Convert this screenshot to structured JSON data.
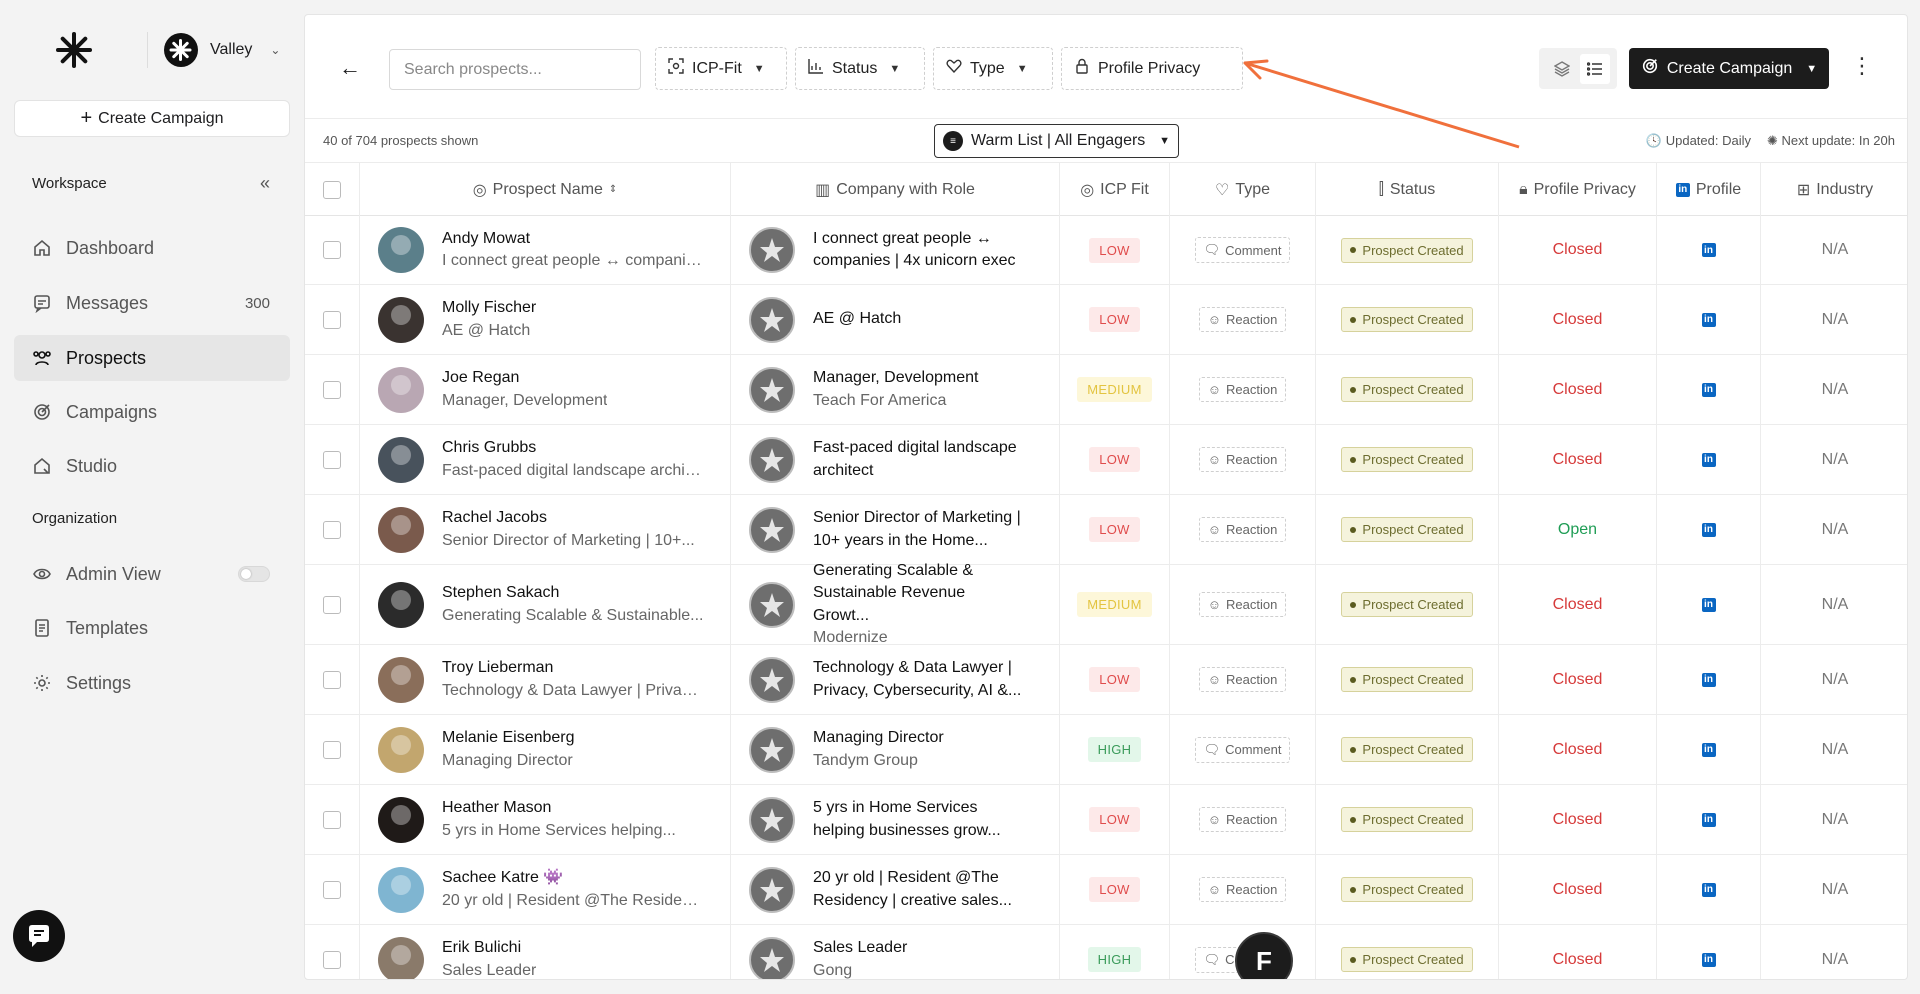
{
  "workspace": {
    "name": "Valley"
  },
  "sidebar": {
    "create_label": "Create Campaign",
    "workspace_label": "Workspace",
    "organization_label": "Organization",
    "items": [
      {
        "label": "Dashboard",
        "icon": "home-icon"
      },
      {
        "label": "Messages",
        "icon": "message-icon",
        "count": "300"
      },
      {
        "label": "Prospects",
        "icon": "users-icon",
        "active": true
      },
      {
        "label": "Campaigns",
        "icon": "target-icon"
      },
      {
        "label": "Studio",
        "icon": "studio-icon"
      }
    ],
    "org_items": [
      {
        "label": "Admin View",
        "icon": "eye-icon"
      },
      {
        "label": "Templates",
        "icon": "document-icon"
      },
      {
        "label": "Settings",
        "icon": "gear-icon"
      }
    ]
  },
  "toolbar": {
    "search_placeholder": "Search prospects...",
    "filters": [
      "ICP-Fit",
      "Status",
      "Type",
      "Profile Privacy"
    ],
    "create_label": "Create Campaign"
  },
  "subbar": {
    "count_text": "40 of 704 prospects shown",
    "list_label": "Warm List | All Engagers",
    "updated": "Updated: Daily",
    "next_update": "Next update: In 20h"
  },
  "columns": [
    "Prospect Name",
    "Company with Role",
    "ICP Fit",
    "Type",
    "Status",
    "Profile Privacy",
    "Profile",
    "Industry"
  ],
  "rows": [
    {
      "name": "Andy Mowat",
      "sub": "I connect great people ↔ companie...",
      "role": "I connect great people ↔ companies | 4x unicorn exec",
      "company": "",
      "icp": "LOW",
      "type": "Comment",
      "status": "Prospect Created",
      "privacy": "Closed",
      "industry": "N/A",
      "avatar": "#5b7f8a"
    },
    {
      "name": "Molly Fischer",
      "sub": "AE @ Hatch",
      "role": "AE @ Hatch",
      "company": "",
      "icp": "LOW",
      "type": "Reaction",
      "status": "Prospect Created",
      "privacy": "Closed",
      "industry": "N/A",
      "avatar": "#3a3330"
    },
    {
      "name": "Joe Regan",
      "sub": "Manager, Development",
      "role": "Manager, Development",
      "company": "Teach For America",
      "icp": "MEDIUM",
      "type": "Reaction",
      "status": "Prospect Created",
      "privacy": "Closed",
      "industry": "N/A",
      "avatar": "#b9a7b3"
    },
    {
      "name": "Chris Grubbs",
      "sub": "Fast-paced digital landscape architect",
      "role": "Fast-paced digital landscape architect",
      "company": "",
      "icp": "LOW",
      "type": "Reaction",
      "status": "Prospect Created",
      "privacy": "Closed",
      "industry": "N/A",
      "avatar": "#48525c"
    },
    {
      "name": "Rachel Jacobs",
      "sub": "Senior Director of Marketing | 10+...",
      "role": "Senior Director of Marketing | 10+ years in the Home...",
      "company": "",
      "icp": "LOW",
      "type": "Reaction",
      "status": "Prospect Created",
      "privacy": "Open",
      "industry": "N/A",
      "avatar": "#7a5a4c"
    },
    {
      "name": "Stephen Sakach",
      "sub": "Generating Scalable & Sustainable...",
      "role": "Generating Scalable & Sustainable Revenue Growt...",
      "company": "Modernize",
      "icp": "MEDIUM",
      "type": "Reaction",
      "status": "Prospect Created",
      "privacy": "Closed",
      "industry": "N/A",
      "avatar": "#2b2b2b"
    },
    {
      "name": "Troy Lieberman",
      "sub": "Technology & Data Lawyer | Privacy,...",
      "role": "Technology & Data Lawyer | Privacy, Cybersecurity, AI &...",
      "company": "",
      "icp": "LOW",
      "type": "Reaction",
      "status": "Prospect Created",
      "privacy": "Closed",
      "industry": "N/A",
      "avatar": "#8a6e5a"
    },
    {
      "name": "Melanie Eisenberg",
      "sub": "Managing Director",
      "role": "Managing Director",
      "company": "Tandym Group",
      "icp": "HIGH",
      "type": "Comment",
      "status": "Prospect Created",
      "privacy": "Closed",
      "industry": "N/A",
      "avatar": "#c2a66e"
    },
    {
      "name": "Heather Mason",
      "sub": "5 yrs in Home Services helping...",
      "role": "5 yrs in Home Services helping businesses grow...",
      "company": "",
      "icp": "LOW",
      "type": "Reaction",
      "status": "Prospect Created",
      "privacy": "Closed",
      "industry": "N/A",
      "avatar": "#1f1a18"
    },
    {
      "name": "Sachee Katre 👾",
      "sub": "20 yr old | Resident @The Residency ...",
      "role": "20 yr old | Resident @The Residency | creative sales...",
      "company": "",
      "icp": "LOW",
      "type": "Reaction",
      "status": "Prospect Created",
      "privacy": "Closed",
      "industry": "N/A",
      "avatar": "#7fb5d1"
    },
    {
      "name": "Erik Bulichi",
      "sub": "Sales Leader",
      "role": "Sales Leader",
      "company": "Gong",
      "icp": "HIGH",
      "type": "Comment",
      "status": "Prospect Created",
      "privacy": "Closed",
      "industry": "N/A",
      "avatar": "#8a7a6a"
    }
  ],
  "colors": {
    "accent": "#1c1c1c",
    "annotation_arrow": "#f0703c",
    "closed": "#d63a3a",
    "open": "#1f9d55",
    "linkedin": "#0a66c2"
  }
}
